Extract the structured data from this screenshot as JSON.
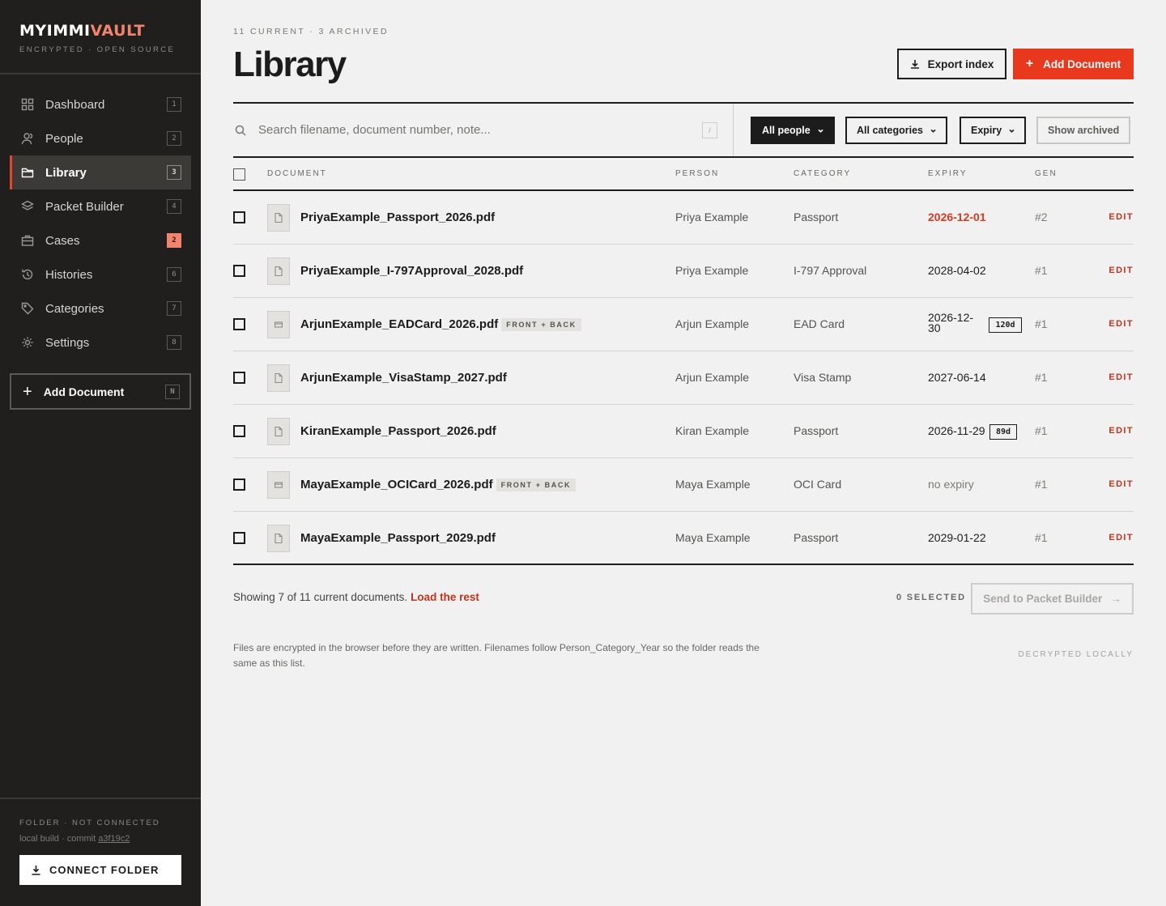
{
  "brand": {
    "name_main": "MYIMMI",
    "name_accent": "VAULT",
    "subtitle": "ENCRYPTED · OPEN SOURCE",
    "accent_color": "#f2846e"
  },
  "sidebar": {
    "items": [
      {
        "label": "Dashboard",
        "key": "1",
        "icon": "grid-icon"
      },
      {
        "label": "People",
        "key": "2",
        "icon": "user-icon"
      },
      {
        "label": "Library",
        "key": "3",
        "icon": "folder-icon",
        "active": true
      },
      {
        "label": "Packet Builder",
        "key": "4",
        "icon": "layers-icon"
      },
      {
        "label": "Cases",
        "key": "2",
        "icon": "briefcase-icon",
        "badge": true
      },
      {
        "label": "Histories",
        "key": "6",
        "icon": "history-icon"
      },
      {
        "label": "Categories",
        "key": "7",
        "icon": "tag-icon"
      },
      {
        "label": "Settings",
        "key": "8",
        "icon": "gear-icon"
      }
    ],
    "add_document": {
      "label": "Add Document",
      "key": "N"
    },
    "footer": {
      "folder_status": "FOLDER · NOT CONNECTED",
      "build_prefix": "local build · commit ",
      "commit": "a3f19c2",
      "connect_label": "CONNECT FOLDER"
    }
  },
  "header": {
    "counts": "11 CURRENT · 3 ARCHIVED",
    "title": "Library",
    "export_label": "Export index",
    "add_label": "Add Document",
    "accent_color": "#e8391f"
  },
  "search": {
    "placeholder": "Search filename, document number, note...",
    "value": "",
    "shortcut": "/"
  },
  "filters": {
    "people": "All people",
    "categories": "All categories",
    "expiry": "Expiry",
    "archived": "Show archived"
  },
  "table": {
    "columns": {
      "document": "DOCUMENT",
      "person": "PERSON",
      "category": "CATEGORY",
      "expiry": "EXPIRY",
      "gen": "GEN"
    },
    "edit_label": "EDIT",
    "rows": [
      {
        "file": "PriyaExample_Passport_2026.pdf",
        "tag": "",
        "person": "Priya Example",
        "category": "Passport",
        "expiry": "2026-12-01",
        "expiry_state": "urgent",
        "days": "",
        "gen": "#2",
        "icon": "file-icon"
      },
      {
        "file": "PriyaExample_I-797Approval_2028.pdf",
        "tag": "",
        "person": "Priya Example",
        "category": "I-797 Approval",
        "expiry": "2028-04-02",
        "expiry_state": "normal",
        "days": "",
        "gen": "#1",
        "icon": "file-icon"
      },
      {
        "file": "ArjunExample_EADCard_2026.pdf",
        "tag": "FRONT + BACK",
        "person": "Arjun Example",
        "category": "EAD Card",
        "expiry": "2026-12-30",
        "expiry_state": "normal",
        "days": "120d",
        "gen": "#1",
        "icon": "card-icon"
      },
      {
        "file": "ArjunExample_VisaStamp_2027.pdf",
        "tag": "",
        "person": "Arjun Example",
        "category": "Visa Stamp",
        "expiry": "2027-06-14",
        "expiry_state": "normal",
        "days": "",
        "gen": "#1",
        "icon": "file-icon"
      },
      {
        "file": "KiranExample_Passport_2026.pdf",
        "tag": "",
        "person": "Kiran Example",
        "category": "Passport",
        "expiry": "2026-11-29",
        "expiry_state": "normal",
        "days": "89d",
        "gen": "#1",
        "icon": "file-icon"
      },
      {
        "file": "MayaExample_OCICard_2026.pdf",
        "tag": "FRONT + BACK",
        "person": "Maya Example",
        "category": "OCI Card",
        "expiry": "no expiry",
        "expiry_state": "none",
        "days": "",
        "gen": "#1",
        "icon": "card-icon"
      },
      {
        "file": "MayaExample_Passport_2029.pdf",
        "tag": "",
        "person": "Maya Example",
        "category": "Passport",
        "expiry": "2029-01-22",
        "expiry_state": "normal",
        "days": "",
        "gen": "#1",
        "icon": "file-icon"
      }
    ]
  },
  "footer": {
    "showing": "Showing 7 of 11 current documents.",
    "load_rest": "Load the rest",
    "selected": "0 SELECTED",
    "send_label": "Send to Packet Builder",
    "note": "Files are encrypted in the browser before they are written. Filenames follow Person_Category_Year so the folder reads the same as this list.",
    "decrypted": "DECRYPTED LOCALLY"
  }
}
